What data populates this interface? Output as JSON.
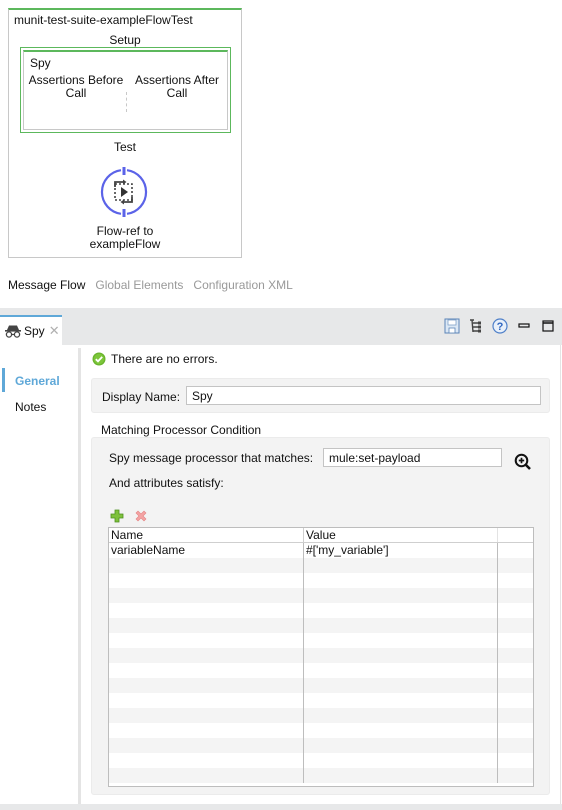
{
  "canvas": {
    "suite_title": "munit-test-suite-exampleFlowTest",
    "setup_label": "Setup",
    "spy_label": "Spy",
    "assertions_before": "Assertions Before Call",
    "assertions_after": "Assertions After Call",
    "test_label": "Test",
    "flowref_label_line1": "Flow-ref to",
    "flowref_label_line2": "exampleFlow",
    "accent_green": "#5cb85c",
    "flowref_color": "#5b63e8"
  },
  "editor_tabs": [
    {
      "label": "Message Flow",
      "active": true
    },
    {
      "label": "Global Elements",
      "active": false
    },
    {
      "label": "Configuration XML",
      "active": false
    }
  ],
  "properties_view": {
    "tab_label": "Spy",
    "tab_icon": "spy-icon",
    "toolbar_icons": [
      "save-icon",
      "outline-tree-icon",
      "help-icon",
      "minimize-icon",
      "maximize-icon"
    ],
    "side_nav": [
      {
        "label": "General",
        "active": true
      },
      {
        "label": "Notes",
        "active": false
      }
    ],
    "status_text": "There are no errors.",
    "display_name_label": "Display Name:",
    "display_name_value": "Spy",
    "section_title": "Matching Processor Condition",
    "processor_label": "Spy message processor that matches:",
    "processor_value": "mule:set-payload",
    "attributes_label": "And attributes satisfy:",
    "table": {
      "columns": [
        "Name",
        "Value",
        ""
      ],
      "rows": [
        {
          "name": "variableName",
          "value": "#['my_variable']"
        }
      ],
      "empty_rows": 15
    },
    "accent_blue": "#5fa8d8"
  }
}
